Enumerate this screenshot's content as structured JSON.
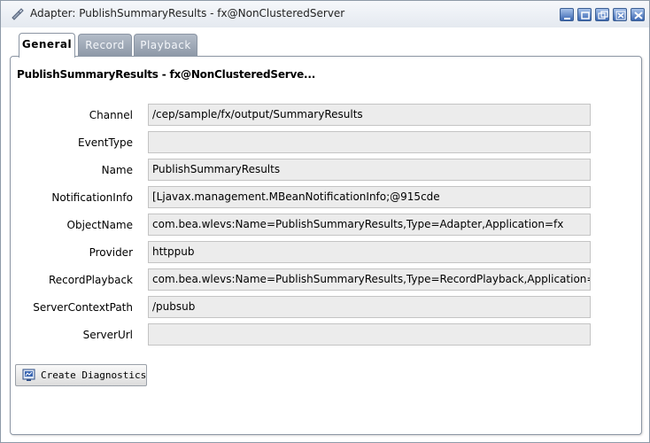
{
  "window": {
    "title": "Adapter: PublishSummaryResults - fx@NonClusteredServer",
    "icon": "adapter-icon",
    "buttons": [
      "minimize",
      "maximize",
      "restore",
      "close-window",
      "close"
    ]
  },
  "tabs": [
    {
      "label": "General",
      "active": true
    },
    {
      "label": "Record",
      "active": false
    },
    {
      "label": "Playback",
      "active": false
    }
  ],
  "panel": {
    "heading": "PublishSummaryResults - fx@NonClusteredServe..."
  },
  "fields": [
    {
      "label": "Channel",
      "value": "/cep/sample/fx/output/SummaryResults"
    },
    {
      "label": "EventType",
      "value": ""
    },
    {
      "label": "Name",
      "value": "PublishSummaryResults"
    },
    {
      "label": "NotificationInfo",
      "value": "[Ljavax.management.MBeanNotificationInfo;@915cde"
    },
    {
      "label": "ObjectName",
      "value": "com.bea.wlevs:Name=PublishSummaryResults,Type=Adapter,Application=fx"
    },
    {
      "label": "Provider",
      "value": "httppub"
    },
    {
      "label": "RecordPlayback",
      "value": "com.bea.wlevs:Name=PublishSummaryResults,Type=RecordPlayback,Application=fx"
    },
    {
      "label": "ServerContextPath",
      "value": "/pubsub"
    },
    {
      "label": "ServerUrl",
      "value": ""
    }
  ],
  "actions": {
    "create_diagnostics": "Create Diagnostics"
  },
  "colors": {
    "title_button": "#3a66b2",
    "field_bg": "#ececec",
    "tab_inactive": "#8c97a6"
  }
}
